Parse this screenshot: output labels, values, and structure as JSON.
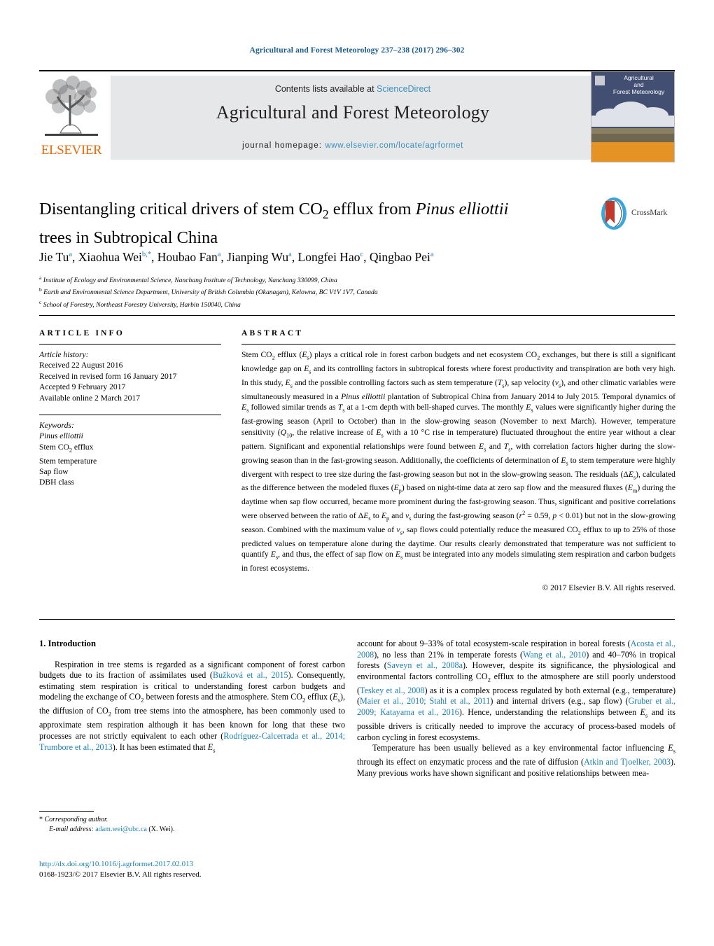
{
  "running_head": "Agricultural and Forest Meteorology 237–238 (2017) 296–302",
  "masthead": {
    "contents_prefix": "Contents lists available at ",
    "sciencedirect": "ScienceDirect",
    "journal_title": "Agricultural and Forest Meteorology",
    "homepage_label": "journal homepage:",
    "homepage_url": "www.elsevier.com/locate/agrformet",
    "publisher": "ELSEVIER",
    "cover_title_line1": "Agricultural",
    "cover_title_line2": "and",
    "cover_title_line3": "Forest Meteorology",
    "link_color": "#3a8fbf",
    "band_color": "#e6e7e8",
    "elsevier_orange": "#eb6a09"
  },
  "article": {
    "title_part1": "Disentangling critical drivers of stem CO",
    "title_sub": "2",
    "title_part2": " efflux from ",
    "title_italic": "Pinus elliottii",
    "title_part3": "trees in Subtropical China",
    "crossmark_label": "CrossMark",
    "authors": [
      {
        "name": "Jie Tu",
        "marks": "a"
      },
      {
        "name": "Xiaohua Wei",
        "marks": "b,*"
      },
      {
        "name": "Houbao Fan",
        "marks": "a"
      },
      {
        "name": "Jianping Wu",
        "marks": "a"
      },
      {
        "name": "Longfei Hao",
        "marks": "c"
      },
      {
        "name": "Qingbao Pei",
        "marks": "a"
      }
    ],
    "affiliations": [
      {
        "mark": "a",
        "text": "Institute of Ecology and Environmental Science, Nanchang Institute of Technology, Nanchang 330099, China"
      },
      {
        "mark": "b",
        "text": "Earth and Environmental Science Department, University of British Columbia (Okanagan), Kelowna, BC V1V 1V7, Canada"
      },
      {
        "mark": "c",
        "text": "School of Forestry, Northeast Forestry University, Harbin 150040, China"
      }
    ]
  },
  "article_info": {
    "heading": "ARTICLE INFO",
    "history_label": "Article history:",
    "history": [
      "Received 22 August 2016",
      "Received in revised form 16 January 2017",
      "Accepted 9 February 2017",
      "Available online 2 March 2017"
    ],
    "keywords_label": "Keywords:",
    "keywords": [
      "Pinus elliottii",
      "Stem CO2 efflux",
      "Stem temperature",
      "Sap flow",
      "DBH class"
    ]
  },
  "abstract": {
    "heading": "ABSTRACT",
    "copyright": "© 2017 Elsevier B.V. All rights reserved."
  },
  "introduction": {
    "heading": "1.  Introduction"
  },
  "footnote": {
    "corresponding_label": "Corresponding author.",
    "email_label": "E-mail address:",
    "email": "adam.wei@ubc.ca",
    "email_suffix": "(X. Wei)."
  },
  "footer": {
    "doi": "http://dx.doi.org/10.1016/j.agrformet.2017.02.013",
    "issn_line": "0168-1923/© 2017 Elsevier B.V. All rights reserved."
  }
}
